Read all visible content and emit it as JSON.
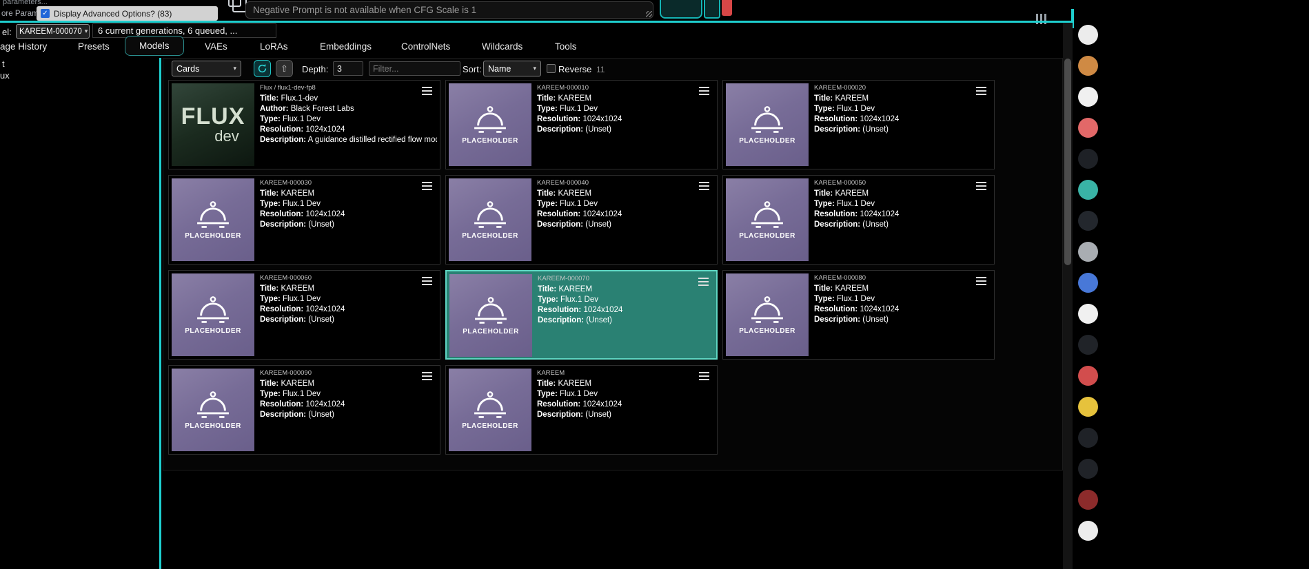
{
  "colors": {
    "accent_teal": "#1ecfcf",
    "selected_card_bg": "#2a8173",
    "selected_card_border": "#5fd6c3",
    "placeholder_purple": "#7c7199",
    "danger_red": "#d84747",
    "check_blue": "#2066d8"
  },
  "top_bar": {
    "clipped_text_top": "parameters...",
    "clipped_text_left": "ore Parame",
    "advanced_options_label": "Display Advanced Options? (83)",
    "advanced_options_checked": true,
    "negative_prompt_text": "Negative Prompt is not available when CFG Scale is 1"
  },
  "model_bar": {
    "label": "el:",
    "current_model": "KAREEM-000070",
    "status_text": "6 current generations, 6 queued, ..."
  },
  "tabs": [
    {
      "label": "age History",
      "active": false
    },
    {
      "label": "Presets",
      "active": false
    },
    {
      "label": "Models",
      "active": true
    },
    {
      "label": "VAEs",
      "active": false
    },
    {
      "label": "LoRAs",
      "active": false
    },
    {
      "label": "Embeddings",
      "active": false
    },
    {
      "label": "ControlNets",
      "active": false
    },
    {
      "label": "Wildcards",
      "active": false
    },
    {
      "label": "Tools",
      "active": false
    }
  ],
  "tree_items": [
    {
      "label": "t"
    },
    {
      "label": "ux"
    }
  ],
  "toolbar": {
    "view_mode": "Cards",
    "depth_label": "Depth:",
    "depth_value": "3",
    "filter_placeholder": "Filter...",
    "sort_label": "Sort:",
    "sort_value": "Name",
    "reverse_label": "Reverse",
    "reverse_checked": false,
    "result_count": "11"
  },
  "field_labels": {
    "title": "Title:",
    "author": "Author:",
    "type": "Type:",
    "resolution": "Resolution:",
    "description": "Description:"
  },
  "placeholder_text": "PLACEHOLDER",
  "flux_logo": {
    "line1": "FLUX",
    "line2": "dev"
  },
  "cards": [
    {
      "path": "Flux / flux1-dev-fp8",
      "title": "Flux.1-dev",
      "author": "Black Forest Labs",
      "type": "Flux.1 Dev",
      "resolution": "1024x1024",
      "description": "A guidance distilled rectified flow model.",
      "selected": false
    },
    {
      "path": "KAREEM-000010",
      "title": "KAREEM",
      "type": "Flux.1 Dev",
      "resolution": "1024x1024",
      "description": "(Unset)",
      "selected": false
    },
    {
      "path": "KAREEM-000020",
      "title": "KAREEM",
      "type": "Flux.1 Dev",
      "resolution": "1024x1024",
      "description": "(Unset)",
      "selected": false
    },
    {
      "path": "KAREEM-000030",
      "title": "KAREEM",
      "type": "Flux.1 Dev",
      "resolution": "1024x1024",
      "description": "(Unset)",
      "selected": false
    },
    {
      "path": "KAREEM-000040",
      "title": "KAREEM",
      "type": "Flux.1 Dev",
      "resolution": "1024x1024",
      "description": "(Unset)",
      "selected": false
    },
    {
      "path": "KAREEM-000050",
      "title": "KAREEM",
      "type": "Flux.1 Dev",
      "resolution": "1024x1024",
      "description": "(Unset)",
      "selected": false
    },
    {
      "path": "KAREEM-000060",
      "title": "KAREEM",
      "type": "Flux.1 Dev",
      "resolution": "1024x1024",
      "description": "(Unset)",
      "selected": false
    },
    {
      "path": "KAREEM-000070",
      "title": "KAREEM",
      "type": "Flux.1 Dev",
      "resolution": "1024x1024",
      "description": "(Unset)",
      "selected": true
    },
    {
      "path": "KAREEM-000080",
      "title": "KAREEM",
      "type": "Flux.1 Dev",
      "resolution": "1024x1024",
      "description": "(Unset)",
      "selected": false
    },
    {
      "path": "KAREEM-000090",
      "title": "KAREEM",
      "type": "Flux.1 Dev",
      "resolution": "1024x1024",
      "description": "(Unset)",
      "selected": false
    },
    {
      "path": "KAREEM",
      "title": "KAREEM",
      "type": "Flux.1 Dev",
      "resolution": "1024x1024",
      "description": "(Unset)",
      "selected": false
    }
  ],
  "right_strip": {
    "icon_colors": [
      "#ececec",
      "#cf8a44",
      "#f0f0f0",
      "#e26868",
      "#1e2126",
      "#39b3a6",
      "#23272d",
      "#a9adb2",
      "#4878d8",
      "#f0f0f0",
      "#202328",
      "#d24d4d",
      "#e6c23c",
      "#1f2227",
      "#202328",
      "#8c2b2b",
      "#ececec"
    ]
  }
}
